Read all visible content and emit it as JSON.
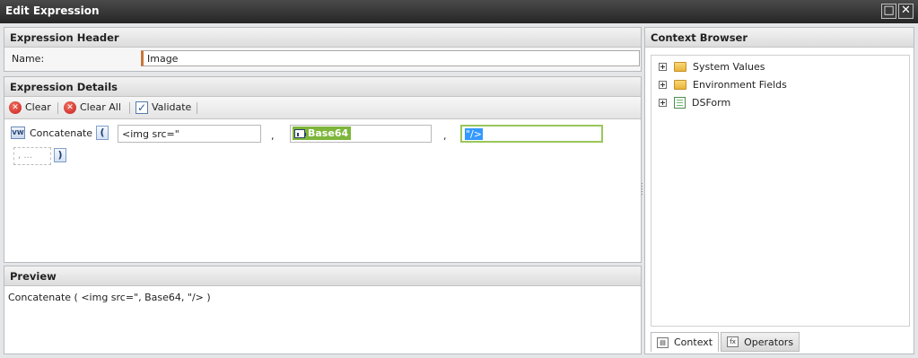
{
  "window": {
    "title": "Edit Expression"
  },
  "header": {
    "title": "Expression Header",
    "name_label": "Name:",
    "name_value": "Image"
  },
  "details": {
    "title": "Expression Details",
    "toolbar": {
      "clear": "Clear",
      "clear_all": "Clear All",
      "validate": "Validate"
    },
    "function": {
      "badge": "VW",
      "name": "Concatenate",
      "open_paren": "(",
      "close_paren": ")"
    },
    "args": [
      {
        "value": "<img src=\""
      },
      {
        "value": "Base64"
      },
      {
        "value": "\"/>"
      }
    ],
    "separator": ",",
    "add_placeholder": ", ..."
  },
  "preview": {
    "title": "Preview",
    "text": "Concatenate ( <img src=\", Base64, \"/> )"
  },
  "context": {
    "title": "Context Browser",
    "tree": [
      {
        "label": "System Values"
      },
      {
        "label": "Environment Fields"
      },
      {
        "label": "DSForm"
      }
    ],
    "tabs": {
      "context": "Context",
      "operators": "Operators"
    }
  },
  "colors": {
    "field_badge": "#7db63b",
    "selection": "#3399ff",
    "name_accent": "#c8763a"
  }
}
